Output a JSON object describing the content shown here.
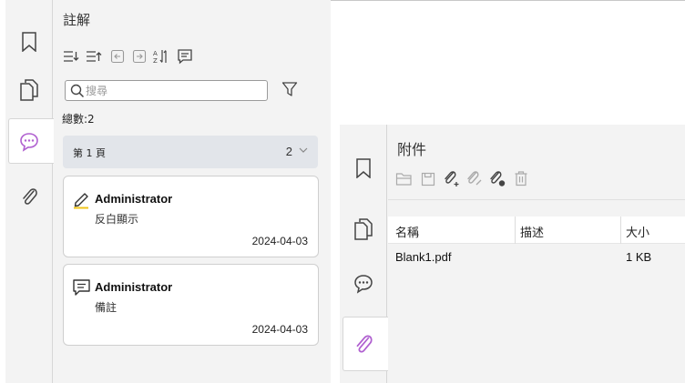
{
  "comments_panel": {
    "title": "註解",
    "search": {
      "placeholder": "搜尋",
      "value": ""
    },
    "total": "總數:2",
    "page_group": {
      "label": "第 1 頁",
      "count": "2"
    },
    "comments": [
      {
        "author": "Administrator",
        "content": "反白顯示",
        "date": "2024-04-03",
        "icon": "highlight-icon"
      },
      {
        "author": "Administrator",
        "content": "備註",
        "date": "2024-04-03",
        "icon": "note-icon"
      }
    ],
    "rail_tabs": [
      "bookmark-icon",
      "pages-icon",
      "comment-icon",
      "attachment-icon"
    ],
    "active_tab": "comment-icon"
  },
  "attachments_panel": {
    "title": "附件",
    "columns": [
      "名稱",
      "描述",
      "大小"
    ],
    "rows": [
      {
        "name": "Blank1.pdf",
        "description": "",
        "size": "1 KB"
      }
    ],
    "rail_tabs": [
      "bookmark-icon",
      "pages-icon",
      "comment-icon",
      "attachment-icon"
    ],
    "active_tab": "attachment-icon"
  },
  "colors": {
    "accent_purple": "#b060d0",
    "highlight_yellow": "#f0c419",
    "panel_bg": "#f3f3f3",
    "group_row_bg": "#e2e5ea"
  }
}
